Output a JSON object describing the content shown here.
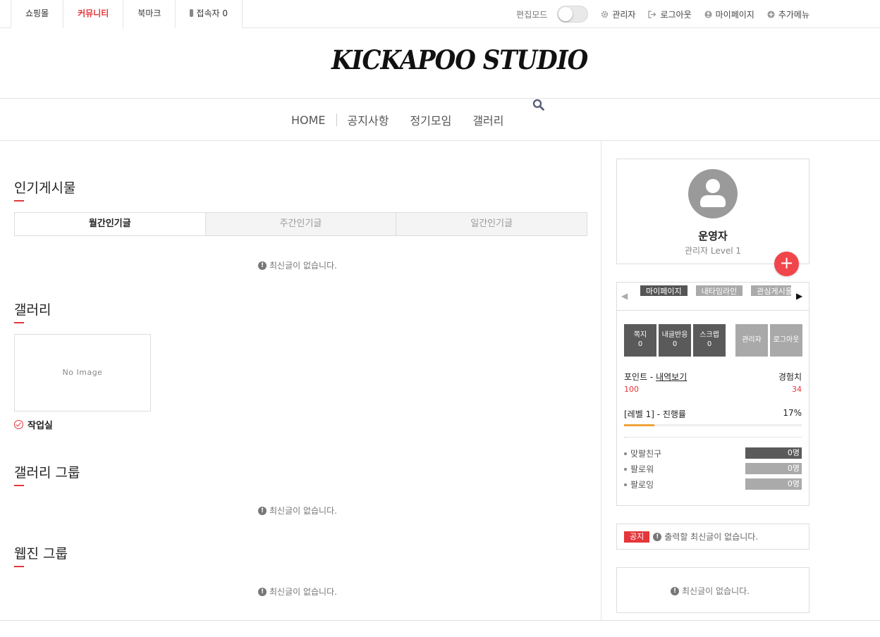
{
  "topbar": {
    "tabs": [
      {
        "label": "쇼핑몰"
      },
      {
        "label": "커뮤니티"
      },
      {
        "label": "북마크"
      },
      {
        "label": "접속자 0"
      }
    ],
    "edit_mode_label": "편집모드",
    "edit_mode_on": false,
    "links": [
      {
        "label": "관리자",
        "icon": "gear-icon"
      },
      {
        "label": "로그아웃",
        "icon": "logout-icon"
      },
      {
        "label": "마이페이지",
        "icon": "user-circle-icon"
      },
      {
        "label": "추가메뉴",
        "icon": "plus-circle-icon"
      }
    ]
  },
  "logo": {
    "text": "KICKAPOO STUDIO"
  },
  "nav": {
    "items": [
      {
        "label": "HOME"
      },
      {
        "label": "공지사항"
      },
      {
        "label": "정기모임"
      },
      {
        "label": "갤러리"
      }
    ],
    "search_icon": "search-icon"
  },
  "main": {
    "popular": {
      "title": "인기게시물",
      "tabs": [
        {
          "label": "월간인기글"
        },
        {
          "label": "주간인기글"
        },
        {
          "label": "일간인기글"
        }
      ],
      "empty": "최신글이 없습니다."
    },
    "gallery": {
      "title": "갤러리",
      "thumb_text": "No Image",
      "caption": "작업실"
    },
    "gallery_group": {
      "title": "갤러리 그룹",
      "empty": "최신글이 없습니다."
    },
    "webzine_group": {
      "title": "웹진 그룹",
      "empty": "최신글이 없습니다."
    }
  },
  "profile": {
    "name": "운영자",
    "level": "관리자 Level 1",
    "plus_label": "+"
  },
  "panel": {
    "chips": [
      {
        "label": "마이페이지"
      },
      {
        "label": "내타임라인"
      },
      {
        "label": "관심게시물"
      }
    ],
    "left_arrow": "◀",
    "right_arrow": "▶",
    "boxes": [
      {
        "label": "쪽지",
        "count": "0"
      },
      {
        "label": "내글반응",
        "count": "0"
      },
      {
        "label": "스크랩",
        "count": "0"
      },
      {
        "label": "관리자"
      },
      {
        "label": "로그아웃"
      }
    ],
    "point_label": "포인트 - ",
    "point_link": "내역보기",
    "exp_label": "경험치",
    "point_value": "100",
    "exp_value": "34",
    "level_label": "[레벨 1] - 진행률",
    "progress_text": "17%",
    "progress": 0.17,
    "stats": [
      {
        "label": "맞팔친구",
        "value": "0명"
      },
      {
        "label": "팔로워",
        "value": "0명"
      },
      {
        "label": "팔로잉",
        "value": "0명"
      }
    ]
  },
  "notice": {
    "badge": "공지",
    "text": "출력할 최신글이 없습니다."
  },
  "latest": {
    "empty": "최신글이 없습니다."
  },
  "colors": {
    "accent": "#e5363a",
    "progress": "#f0a43a",
    "plus": "#f0464b"
  }
}
